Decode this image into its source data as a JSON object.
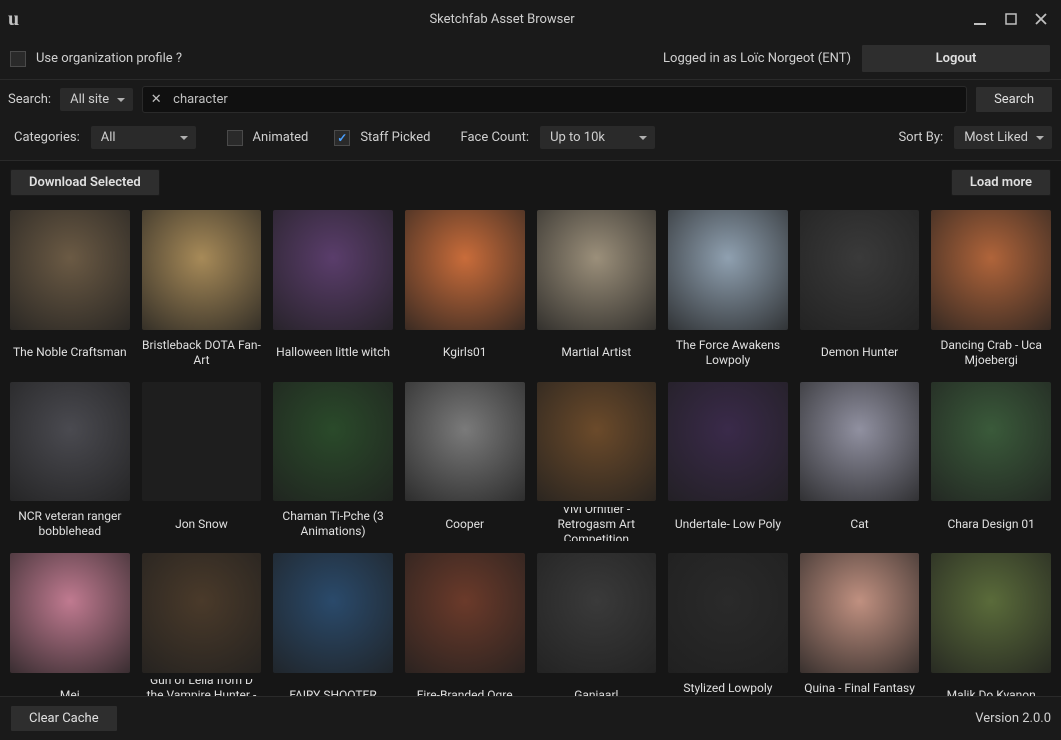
{
  "window": {
    "title": "Sketchfab Asset Browser"
  },
  "header": {
    "org_profile_label": "Use organization profile ?",
    "logged_in_text": "Logged in as Loïc Norgeot (ENT)",
    "logout_label": "Logout"
  },
  "search": {
    "label": "Search:",
    "scope_selected": "All site",
    "query": "character",
    "search_button": "Search"
  },
  "filters": {
    "categories_label": "Categories:",
    "categories_selected": "All",
    "animated_label": "Animated",
    "animated_checked": false,
    "staff_picked_label": "Staff Picked",
    "staff_picked_checked": true,
    "face_count_label": "Face Count:",
    "face_count_selected": "Up to 10k",
    "sort_by_label": "Sort By:",
    "sort_by_selected": "Most Liked"
  },
  "actions": {
    "download_selected": "Download Selected",
    "load_more": "Load more",
    "clear_cache": "Clear Cache"
  },
  "version": "Version 2.0.0",
  "thumb_colors": [
    "#6b5a44",
    "#a78a58",
    "#5a3d6b",
    "#c96c3a",
    "#9b8f7a",
    "#8fa0b0",
    "#3a3a3a",
    "#b0643a",
    "#4a4a50",
    "#1e1e1e",
    "#2a4a2a",
    "#7a7a7a",
    "#6b4a2a",
    "#3a2a4a",
    "#9090a0",
    "#3a5a3a",
    "#c07a90",
    "#4a3a2a",
    "#2a4a6b",
    "#6b3a2a",
    "#3a3a3a",
    "#2a2a2a",
    "#c09080",
    "#5a6b3a"
  ],
  "assets": [
    {
      "name": "The Noble Craftsman"
    },
    {
      "name": "Bristleback DOTA Fan-Art"
    },
    {
      "name": "Halloween little witch"
    },
    {
      "name": "Kgirls01"
    },
    {
      "name": "Martial Artist"
    },
    {
      "name": "The Force Awakens Lowpoly"
    },
    {
      "name": "Demon Hunter"
    },
    {
      "name": "Dancing Crab - Uca Mjoebergi"
    },
    {
      "name": "NCR veteran ranger bobblehead"
    },
    {
      "name": "Jon Snow"
    },
    {
      "name": "Chaman Ti-Pche (3 Animations)"
    },
    {
      "name": "Cooper"
    },
    {
      "name": "Vivi Ornitier - Retrogasm Art Competition"
    },
    {
      "name": "Undertale- Low Poly"
    },
    {
      "name": "Cat"
    },
    {
      "name": "Chara Design 01"
    },
    {
      "name": "Mei"
    },
    {
      "name": "Gun of Leila from D the Vampire Hunter - Blood L..."
    },
    {
      "name": "FAIRY SHOOTER"
    },
    {
      "name": "Fire-Branded Ogre"
    },
    {
      "name": "Ganjaarl"
    },
    {
      "name": "Stylized Lowpoly Female"
    },
    {
      "name": "Quina - Final Fantasy IX (Fan Art)"
    },
    {
      "name": "Malik Do Kyanon"
    }
  ]
}
